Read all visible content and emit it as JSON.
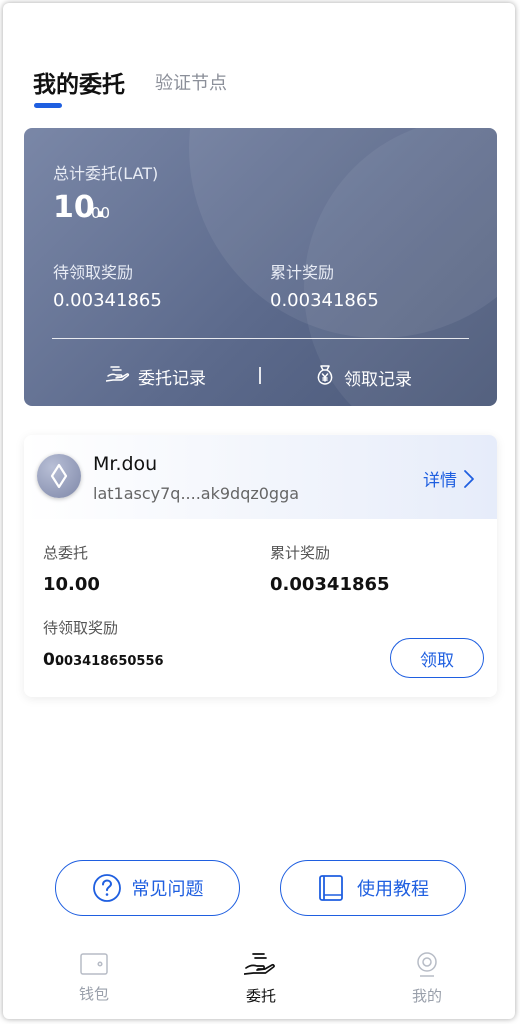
{
  "tabs": {
    "active": "我的委托",
    "inactive": "验证节点"
  },
  "summary": {
    "total_label": "总计委托(LAT)",
    "total_int": "10.",
    "total_dec": "00",
    "pending_label": "待领取奖励",
    "pending_value": "0.00341865",
    "cumulative_label": "累计奖励",
    "cumulative_value": "0.00341865",
    "delegate_record": "委托记录",
    "claim_record": "领取记录"
  },
  "node": {
    "name": "Mr.dou",
    "address": "lat1ascy7q....ak9dqz0gga",
    "detail": "详情",
    "total_label": "总委托",
    "total_value": "10.00",
    "cumulative_label": "累计奖励",
    "cumulative_value": "0.00341865",
    "pending_label": "待领取奖励",
    "pending_big": "0.",
    "pending_small": "003418650556",
    "claim_button": "领取"
  },
  "help": {
    "faq": "常见问题",
    "tutorial": "使用教程"
  },
  "nav": {
    "items": [
      {
        "label": "钱包",
        "icon": "wallet-icon",
        "active": false
      },
      {
        "label": "委托",
        "icon": "delegate-hand-icon",
        "active": true
      },
      {
        "label": "我的",
        "icon": "profile-icon",
        "active": false
      }
    ]
  },
  "colors": {
    "accent": "#1f5fe0",
    "card": "#5c6a8c",
    "inactive": "#9aa0ab"
  }
}
